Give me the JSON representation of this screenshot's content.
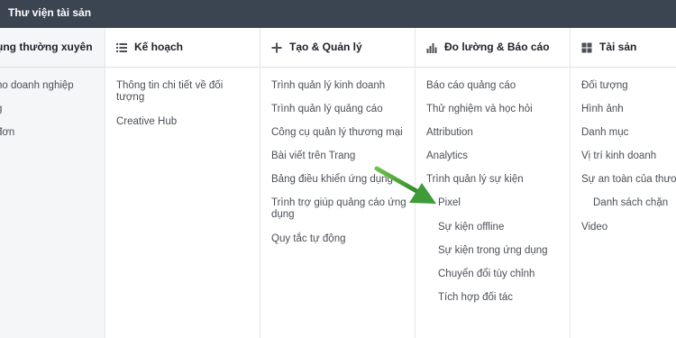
{
  "topbar": {
    "title": "Thư viện tài sản"
  },
  "columns": [
    {
      "title": "ụng thường xuyên",
      "icon": "none",
      "items": [
        {
          "label": "ho doanh nghiệp"
        },
        {
          "label": "g"
        },
        {
          "label": "đơn"
        }
      ]
    },
    {
      "title": "Kế hoạch",
      "icon": "list-icon",
      "items": [
        {
          "label": "Thông tin chi tiết về đối tượng"
        },
        {
          "label": "Creative Hub"
        }
      ]
    },
    {
      "title": "Tạo & Quản lý",
      "icon": "plus-icon",
      "items": [
        {
          "label": "Trình quản lý kinh doanh"
        },
        {
          "label": "Trình quản lý quảng cáo"
        },
        {
          "label": "Công cụ quản lý thương mại"
        },
        {
          "label": "Bài viết trên Trang"
        },
        {
          "label": "Bảng điều khiển ứng dụng"
        },
        {
          "label": "Trình trợ giúp quảng cáo ứng dụng"
        },
        {
          "label": "Quy tắc tự động"
        }
      ]
    },
    {
      "title": "Đo lường & Báo cáo",
      "icon": "bar-chart-icon",
      "items": [
        {
          "label": "Báo cáo quảng cáo"
        },
        {
          "label": "Thử nghiệm và học hỏi"
        },
        {
          "label": "Attribution"
        },
        {
          "label": "Analytics"
        },
        {
          "label": "Trình quản lý sự kiện"
        },
        {
          "label": "Pixel"
        },
        {
          "label": "Sự kiện offline"
        },
        {
          "label": "Sự kiện trong ứng dụng"
        },
        {
          "label": "Chuyển đổi tùy chỉnh"
        },
        {
          "label": "Tích hợp đối tác"
        }
      ]
    },
    {
      "title": "Tài sản",
      "icon": "grid-icon",
      "items": [
        {
          "label": "Đối tượng"
        },
        {
          "label": "Hình ảnh"
        },
        {
          "label": "Danh mục"
        },
        {
          "label": "Vị trí kinh doanh"
        },
        {
          "label": "Sự an toàn của thươ"
        },
        {
          "label": "Danh sách chặn"
        },
        {
          "label": "Video"
        }
      ]
    }
  ],
  "colors": {
    "topbar": "#3b4451",
    "text": "#4b4f56",
    "heading": "#1d2129",
    "arrow": "#3f9a3a"
  },
  "annotation": {
    "icon": "green-arrow-icon"
  }
}
